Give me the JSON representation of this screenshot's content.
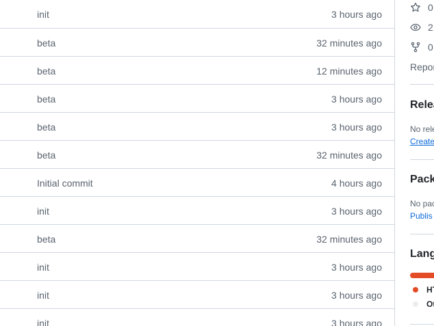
{
  "commits": [
    {
      "message": "init",
      "time": "3 hours ago"
    },
    {
      "message": "beta",
      "time": "32 minutes ago"
    },
    {
      "message": "beta",
      "time": "12 minutes ago"
    },
    {
      "message": "beta",
      "time": "3 hours ago"
    },
    {
      "message": "beta",
      "time": "3 hours ago"
    },
    {
      "message": "beta",
      "time": "32 minutes ago"
    },
    {
      "message": "Initial commit",
      "time": "4 hours ago"
    },
    {
      "message": "init",
      "time": "3 hours ago"
    },
    {
      "message": "beta",
      "time": "32 minutes ago"
    },
    {
      "message": "init",
      "time": "3 hours ago"
    },
    {
      "message": "init",
      "time": "3 hours ago"
    },
    {
      "message": "init",
      "time": "3 hours ago"
    }
  ],
  "sidebar": {
    "stars": "0",
    "watching": "2",
    "forks": "0",
    "report_text": "Repor",
    "releases": {
      "title": "Relea",
      "empty_text": "No rele",
      "create_link": "Create"
    },
    "packages": {
      "title": "Pack",
      "empty_text": "No pac",
      "publish_link": "Publis"
    },
    "languages": {
      "title": "Lang",
      "items": [
        {
          "name": "HT",
          "color": "#e34c26"
        },
        {
          "name": "Ot",
          "color": "#ededed"
        }
      ]
    }
  }
}
